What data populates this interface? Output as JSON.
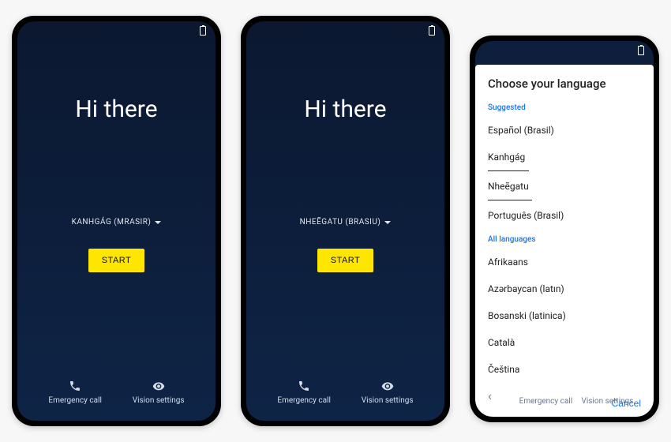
{
  "phone1": {
    "greeting": "Hi there",
    "language": "KANHGÁG (MRASIR)",
    "start_label": "START",
    "emergency_label": "Emergency call",
    "vision_label": "Vision settings"
  },
  "phone2": {
    "greeting": "Hi there",
    "language": "NHEẼGATU (BRASIU)",
    "start_label": "START",
    "emergency_label": "Emergency call",
    "vision_label": "Vision settings"
  },
  "phone3": {
    "title": "Choose your language",
    "suggested_label": "Suggested",
    "suggested": {
      "0": "Español (Brasil)",
      "1": "Kanhgág",
      "2": "Nheẽgatu",
      "3": "Português (Brasil)"
    },
    "all_label": "All languages",
    "all": {
      "0": "Afrikaans",
      "1": "Azərbaycan (latın)",
      "2": "Bosanski (latinica)",
      "3": "Català",
      "4": "Čeština"
    },
    "cancel_label": "Cancel",
    "emergency_label": "Emergency call",
    "vision_label": "Vision settings"
  },
  "colors": {
    "accent": "#ffe600",
    "link": "#1a73e8"
  }
}
